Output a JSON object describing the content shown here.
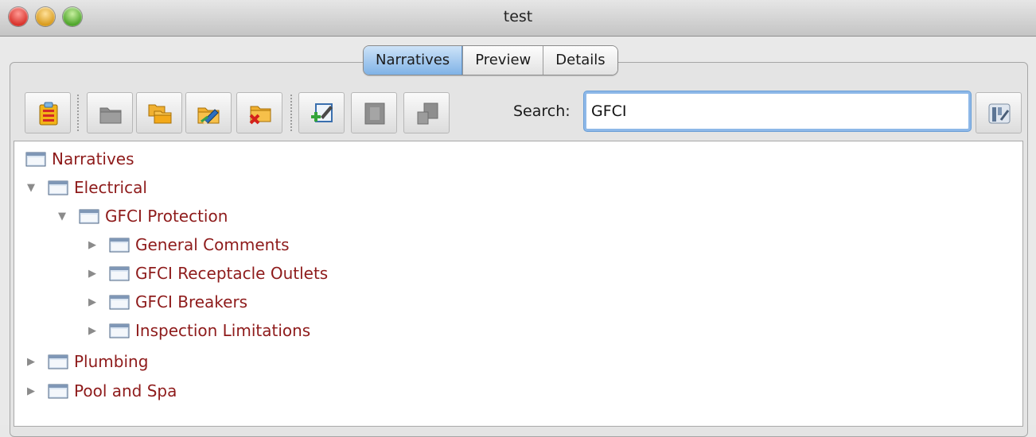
{
  "window": {
    "title": "test"
  },
  "tabs": [
    {
      "label": "Narratives",
      "active": true
    },
    {
      "label": "Preview",
      "active": false
    },
    {
      "label": "Details",
      "active": false
    }
  ],
  "toolbar": {
    "buttons": [
      {
        "icon": "clipboard-list-icon",
        "enabled": true
      },
      {
        "icon": "folder-icon",
        "enabled": false
      },
      {
        "icon": "folders-icon",
        "enabled": true
      },
      {
        "icon": "folder-edit-icon",
        "enabled": true
      },
      {
        "icon": "folder-delete-icon",
        "enabled": true
      },
      {
        "icon": "add-item-icon",
        "enabled": true
      },
      {
        "icon": "item-icon",
        "enabled": false
      },
      {
        "icon": "item-move-icon",
        "enabled": false
      }
    ],
    "search_label": "Search:",
    "search_value": "GFCI",
    "search_button_icon": "search-filter-icon"
  },
  "tree": {
    "root": "Narratives",
    "items": [
      {
        "label": "Electrical",
        "expanded": true
      },
      {
        "label": "GFCI Protection",
        "expanded": true
      },
      {
        "label": "General Comments",
        "expanded": false
      },
      {
        "label": "GFCI Receptacle Outlets",
        "expanded": false
      },
      {
        "label": "GFCI Breakers",
        "expanded": false
      },
      {
        "label": "Inspection Limitations",
        "expanded": false
      },
      {
        "label": "Plumbing",
        "expanded": false
      },
      {
        "label": "Pool and Spa",
        "expanded": false
      }
    ]
  },
  "colors": {
    "node_text": "#8e1b1b",
    "tab_active": "#7fb2e6",
    "search_focus": "#8db8e8"
  }
}
